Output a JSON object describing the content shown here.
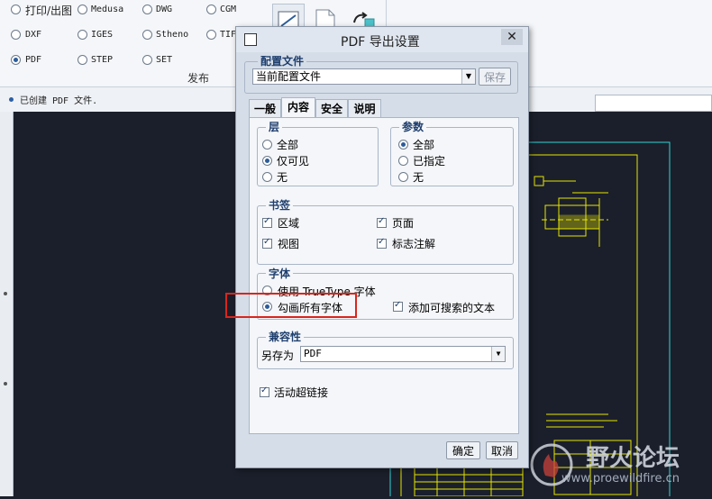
{
  "ribbon": {
    "export_options": [
      {
        "label": "打印/出图",
        "selected": false
      },
      {
        "label": "Medusa",
        "selected": false
      },
      {
        "label": "DWG",
        "selected": false
      },
      {
        "label": "CGM",
        "selected": false
      },
      {
        "label": "DXF",
        "selected": false
      },
      {
        "label": "IGES",
        "selected": false
      },
      {
        "label": "Stheno",
        "selected": false
      },
      {
        "label": "TIF",
        "selected": false
      },
      {
        "label": "PDF",
        "selected": true
      },
      {
        "label": "STEP",
        "selected": false
      },
      {
        "label": "SET",
        "selected": false
      }
    ],
    "group_label": "发布"
  },
  "status": {
    "message": "已创建 PDF 文件."
  },
  "dialog": {
    "title": "PDF 导出设置",
    "config_section": {
      "title": "配置文件",
      "combo_value": "当前配置文件",
      "save_label": "保存"
    },
    "tabs": [
      {
        "label": "一般",
        "active": false
      },
      {
        "label": "内容",
        "active": true
      },
      {
        "label": "安全",
        "active": false
      },
      {
        "label": "说明",
        "active": false
      }
    ],
    "layers": {
      "title": "层",
      "options": [
        {
          "label": "全部",
          "selected": false
        },
        {
          "label": "仅可见",
          "selected": true
        },
        {
          "label": "无",
          "selected": false
        }
      ]
    },
    "params": {
      "title": "参数",
      "options": [
        {
          "label": "全部",
          "selected": true
        },
        {
          "label": "已指定",
          "selected": false
        },
        {
          "label": "无",
          "selected": false
        }
      ]
    },
    "bookmarks": {
      "title": "书签",
      "items": [
        {
          "label": "区域",
          "checked": true
        },
        {
          "label": "页面",
          "checked": true
        },
        {
          "label": "视图",
          "checked": true
        },
        {
          "label": "标志注解",
          "checked": true
        }
      ]
    },
    "fonts": {
      "title": "字体",
      "options": [
        {
          "label": "使用 TrueType 字体",
          "selected": false
        },
        {
          "label": "勾画所有字体",
          "selected": true
        }
      ],
      "searchable_text": {
        "label": "添加可搜索的文本",
        "checked": true
      }
    },
    "compat": {
      "title": "兼容性",
      "save_as_label": "另存为",
      "save_as_value": "PDF"
    },
    "hyperlinks": {
      "label": "活动超链接",
      "checked": true
    },
    "ok_label": "确定",
    "cancel_label": "取消"
  },
  "watermark": {
    "name": "野火论坛",
    "url": "www.proewildfire.cn"
  },
  "colors": {
    "highlight": "#d9261c",
    "accent": "#1f3f6e",
    "canvas": "#1b1f2b",
    "drawing_lines": "#33d6d6"
  }
}
